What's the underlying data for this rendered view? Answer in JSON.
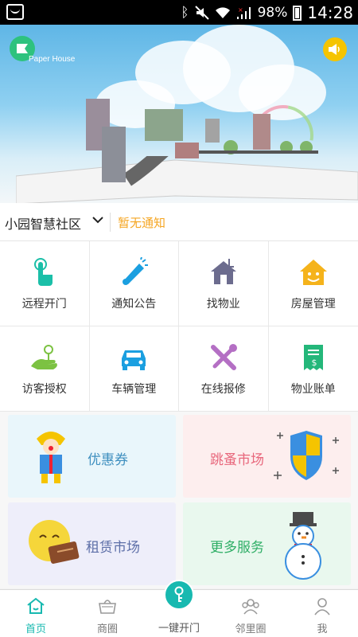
{
  "status_bar": {
    "battery": "98%",
    "time": "14:28"
  },
  "banner": {
    "brand": "Paper House"
  },
  "community": {
    "name": "小园智慧社区",
    "notice": "暂无通知"
  },
  "services": [
    {
      "label": "远程开门",
      "icon": "remote-door-icon",
      "color": "#1bbfa8"
    },
    {
      "label": "通知公告",
      "icon": "megaphone-icon",
      "color": "#1b9fe0"
    },
    {
      "label": "找物业",
      "icon": "house-icon",
      "color": "#6c6c8e"
    },
    {
      "label": "房屋管理",
      "icon": "smile-house-icon",
      "color": "#f5b31b"
    },
    {
      "label": "访客授权",
      "icon": "visitor-hand-icon",
      "color": "#7cc242"
    },
    {
      "label": "车辆管理",
      "icon": "car-icon",
      "color": "#1b9fe0"
    },
    {
      "label": "在线报修",
      "icon": "tools-icon",
      "color": "#b46fc4"
    },
    {
      "label": "物业账单",
      "icon": "bill-icon",
      "color": "#24b77a"
    }
  ],
  "cards": [
    {
      "label": "优惠券",
      "color": "#3e8fbf",
      "bg": "#e9f6fb",
      "icon": "clown-gift-icon"
    },
    {
      "label": "跳蚤市场",
      "color": "#e8677c",
      "bg": "#fdeeee",
      "icon": "shield-icon"
    },
    {
      "label": "租赁市场",
      "color": "#5d6fa8",
      "bg": "#eeeefa",
      "icon": "smiley-sign-icon"
    },
    {
      "label": "更多服务",
      "color": "#2fae66",
      "bg": "#e9f8ee",
      "icon": "snowman-icon"
    }
  ],
  "tabs": [
    {
      "label": "首页",
      "icon": "home-icon",
      "active": true
    },
    {
      "label": "商圈",
      "icon": "shop-basket-icon",
      "active": false
    },
    {
      "label": "一键开门",
      "icon": "key-icon",
      "active": false
    },
    {
      "label": "邻里圈",
      "icon": "neighbors-icon",
      "active": false
    },
    {
      "label": "我",
      "icon": "profile-icon",
      "active": false
    }
  ],
  "accent": "#18b9b0"
}
